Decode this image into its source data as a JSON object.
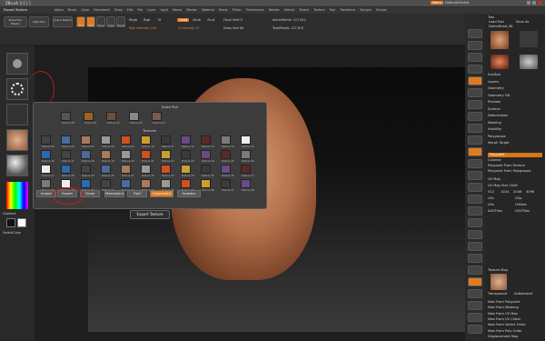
{
  "window": {
    "title": "ZBrush 3.1 [ ]",
    "app_title_right": "DefaultZScript",
    "menu_button_right": "Menu"
  },
  "menu": [
    "Alpha",
    "Brush",
    "Color",
    "Document",
    "Draw",
    "Edit",
    "File",
    "Layer",
    "Light",
    "Macro",
    "Marker",
    "Material",
    "Movie",
    "Picker",
    "Preferences",
    "Render",
    "Stencil",
    "Stroke",
    "Texture",
    "Tool",
    "Transform",
    "Zplugin",
    "Zscript"
  ],
  "toolbar": {
    "left_label": "Export Texture",
    "projection_master": "Projection Master",
    "light_box": "Light Box",
    "quick_sketch": "Quick Sketch",
    "modes": [
      "Edit",
      "Draw",
      "Move",
      "Scale",
      "Rotate"
    ],
    "mrgb": "Mrgb",
    "rgb": "Rgb",
    "m": "M",
    "zadd": "Zadd",
    "zsub": "Zsub",
    "zcut": "Zcut",
    "focal_shift": "Focal Shift 0",
    "draw_size": "Draw Size 64",
    "z_intensity": "Z Intensity 25",
    "rgb_intensity": "Rgb Intensity 100",
    "active_points": "ActivePoints: 127,612",
    "total_points": "TotalPoints: 127,612"
  },
  "left_panel": {
    "gradient": "Gradient",
    "switch_color": "SwitchColor"
  },
  "texture_popup": {
    "quick_pick": "Quick Pick",
    "section_label": "Textures",
    "quick_items": [
      "Texture Off",
      "Texture 01",
      "Texture 02",
      "Texture 03",
      "Texture 04"
    ],
    "grid_items": [
      "Texture 05",
      "Texture 06",
      "Texture 07",
      "Texture 08",
      "Texture 09",
      "Texture 10",
      "Texture 11",
      "Texture 12",
      "Texture 13",
      "Texture 14",
      "Texture 15",
      "Texture 16",
      "Texture 17",
      "Texture 18",
      "Texture 19",
      "Texture 20",
      "Texture 21",
      "Texture 22",
      "Texture 23",
      "Texture 24",
      "Texture 25",
      "Texture 26",
      "Texture 27",
      "Texture 28",
      "Texture 29",
      "Texture 30",
      "Texture 31",
      "Texture 32",
      "Texture 33",
      "Texture 34",
      "Texture 35",
      "Texture 36",
      "Texture 37",
      "Texture 38",
      "Texture 39",
      "Texture 40",
      "Texture 41",
      "Texture 42",
      "Texture 43",
      "Texture 44",
      "Texture 45",
      "Texture 46",
      "Texture 47",
      "Texture 48"
    ],
    "buttons": [
      "Import",
      "Export",
      "Clone",
      "MakeAlpha",
      "FlipV",
      "GrapheditV",
      "Grabdoc"
    ]
  },
  "tooltip": "Export Texture",
  "right_panel": {
    "tool_label": "Tool",
    "load_tool": "Load Tool",
    "save_as": "Save As",
    "clone": "Clone",
    "make_polymesh": "Make PolyMesh3D",
    "current_tool": "DemoHead_08",
    "tool_thumbs": [
      "DemoHead",
      "SimpleBrush",
      "Sphere3D",
      "PolySphere"
    ],
    "sections": [
      "SubTool",
      "Layers",
      "Geometry",
      "Geometry HD",
      "Preview",
      "Surface",
      "Deformation",
      "Masking",
      "Visibility",
      "Polygroups",
      "Morph Target"
    ],
    "polypaint_header": "Polypaint",
    "colorize": "Colorize",
    "polypaint_from_texture": "Polypaint From Texture",
    "polypaint_from_polygroups": "Polypaint From Polygroups",
    "uv_map_label": "UV Map",
    "uv_map_size": "UV Map Size 2048",
    "uv_items": [
      "UVc",
      "UVp",
      "UVs",
      "UVtiles",
      "AUVTiles",
      "GUVTiles"
    ],
    "uv_sizes": [
      "512",
      "1024",
      "2048",
      "4096"
    ],
    "texture_map_label": "Texture Map",
    "transparent": "Transparent",
    "antialiased": "Antialiased",
    "texture_actions": [
      "New From Polypaint",
      "New From Masking",
      "New From UV Map",
      "New From UV Check",
      "New From Vertex Order",
      "New From Poly Order"
    ],
    "displacement_map": "Displacement Map"
  },
  "colors": {
    "accent": "#e07a22",
    "highlight": "#d81919",
    "panel": "#262626"
  }
}
